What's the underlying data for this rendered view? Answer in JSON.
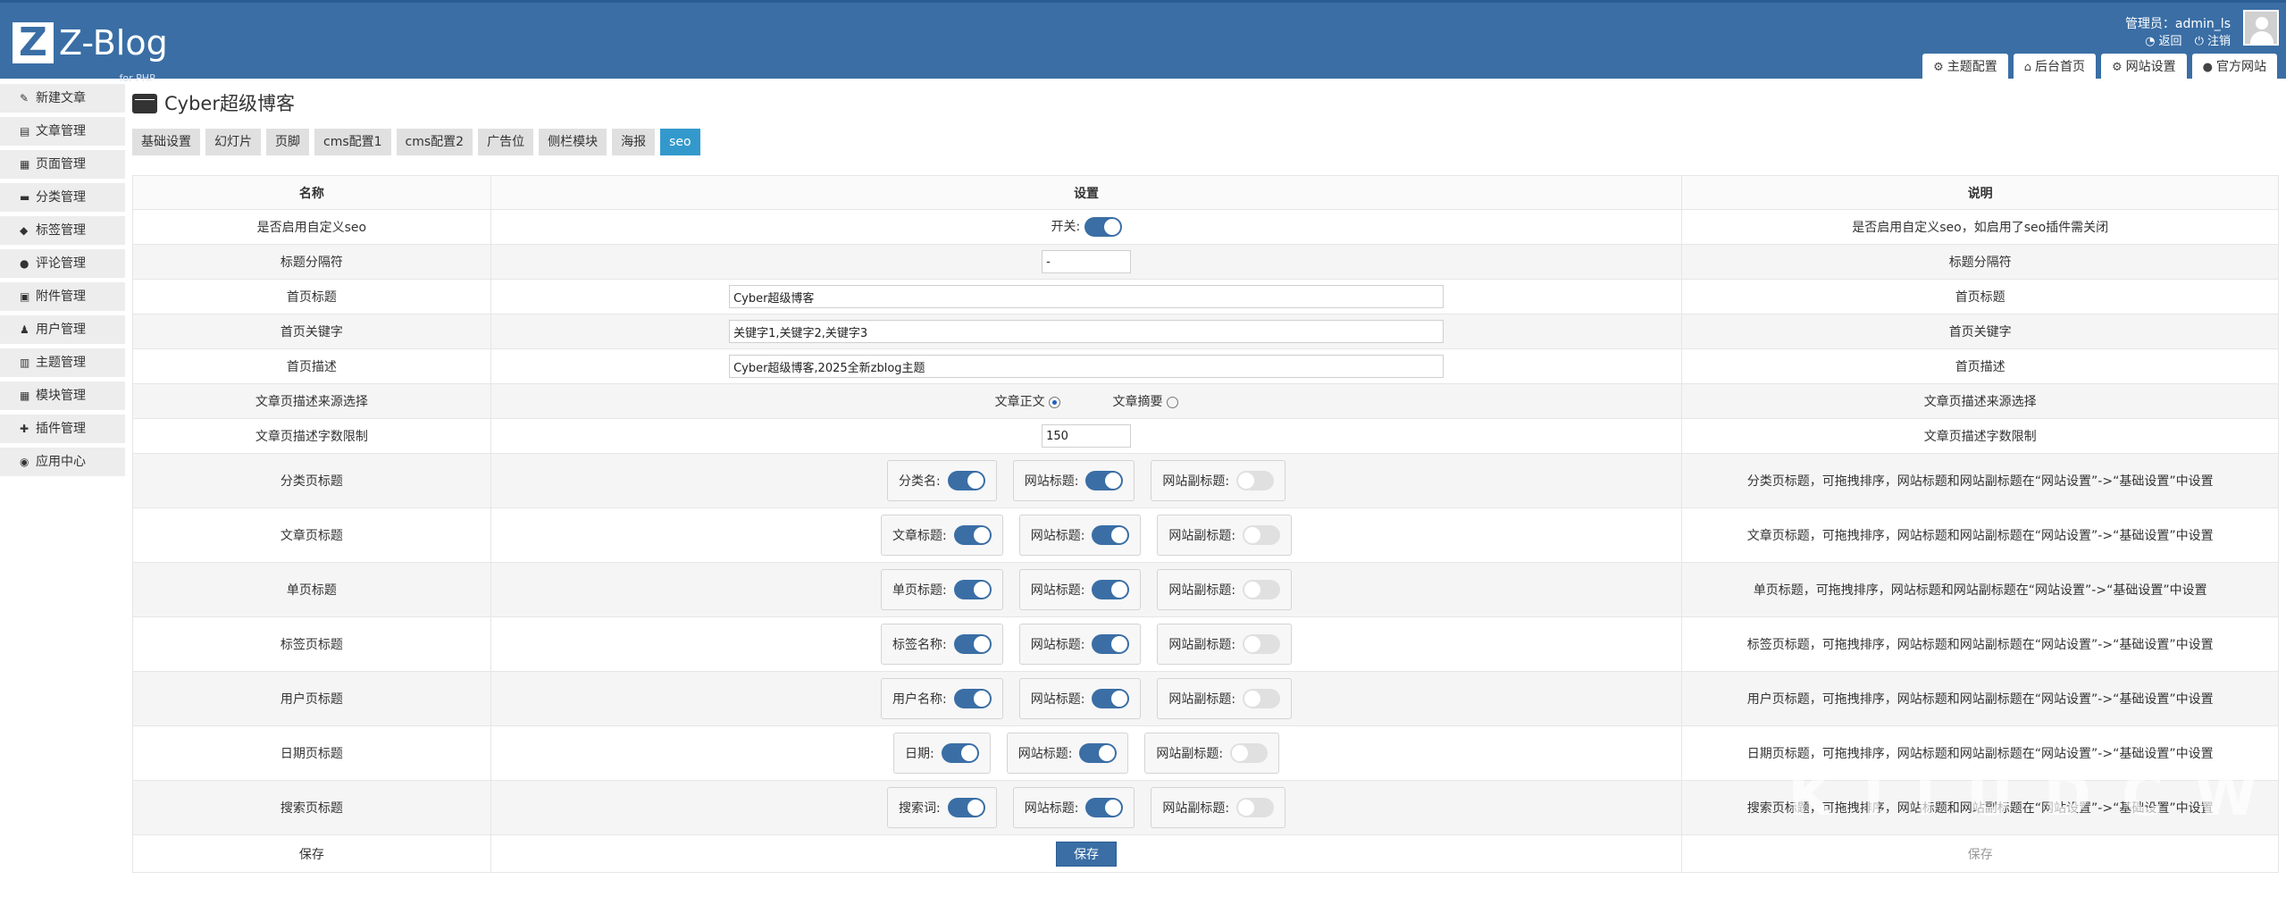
{
  "header": {
    "logo_letter": "Z",
    "logo_text": "Z-Blog",
    "logo_sub": "for PHP",
    "admin_label": "管理员：admin_ls",
    "back_label": "返回",
    "logout_label": "注销",
    "tabs": [
      {
        "icon": "⚙",
        "label": "主题配置"
      },
      {
        "icon": "⌂",
        "label": "后台首页"
      },
      {
        "icon": "⚙",
        "label": "网站设置"
      },
      {
        "icon": "●",
        "label": "官方网站"
      }
    ]
  },
  "sidebar": {
    "items": [
      {
        "icon": "✎",
        "label": "新建文章"
      },
      {
        "icon": "▤",
        "label": "文章管理"
      },
      {
        "icon": "▦",
        "label": "页面管理"
      },
      {
        "icon": "▬",
        "label": "分类管理"
      },
      {
        "icon": "◆",
        "label": "标签管理"
      },
      {
        "icon": "●",
        "label": "评论管理"
      },
      {
        "icon": "▣",
        "label": "附件管理"
      },
      {
        "icon": "♟",
        "label": "用户管理"
      },
      {
        "icon": "▥",
        "label": "主题管理"
      },
      {
        "icon": "▦",
        "label": "模块管理"
      },
      {
        "icon": "✚",
        "label": "插件管理"
      },
      {
        "icon": "◉",
        "label": "应用中心"
      }
    ]
  },
  "main": {
    "title": "Cyber超级博客",
    "tabs": [
      "基础设置",
      "幻灯片",
      "页脚",
      "cms配置1",
      "cms配置2",
      "广告位",
      "侧栏模块",
      "海报",
      "seo"
    ],
    "active_tab": "seo",
    "table": {
      "headers": [
        "名称",
        "设置",
        "说明"
      ],
      "enable_seo": {
        "name": "是否启用自定义seo",
        "switch_label": "开关:",
        "on": true,
        "desc": "是否启用自定义seo，如启用了seo插件需关闭"
      },
      "separator": {
        "name": "标题分隔符",
        "value": "-",
        "desc": "标题分隔符"
      },
      "home_title": {
        "name": "首页标题",
        "value": "Cyber超级博客",
        "desc": "首页标题"
      },
      "home_keywords": {
        "name": "首页关键字",
        "value": "关键字1,关键字2,关键字3",
        "desc": "首页关键字"
      },
      "home_desc": {
        "name": "首页描述",
        "value": "Cyber超级博客,2025全新zblog主题",
        "desc": "首页描述"
      },
      "article_desc_source": {
        "name": "文章页描述来源选择",
        "option1": "文章正文",
        "option2": "文章摘要",
        "selected": "文章正文",
        "desc": "文章页描述来源选择"
      },
      "article_desc_limit": {
        "name": "文章页描述字数限制",
        "value": "150",
        "desc": "文章页描述字数限制"
      },
      "title_rows": [
        {
          "name": "分类页标题",
          "s1": "分类名:",
          "s1_on": true,
          "s2": "网站标题:",
          "s2_on": true,
          "s3": "网站副标题:",
          "s3_on": false,
          "desc": "分类页标题，可拖拽排序，网站标题和网站副标题在“网站设置”->“基础设置”中设置"
        },
        {
          "name": "文章页标题",
          "s1": "文章标题:",
          "s1_on": true,
          "s2": "网站标题:",
          "s2_on": true,
          "s3": "网站副标题:",
          "s3_on": false,
          "desc": "文章页标题，可拖拽排序，网站标题和网站副标题在“网站设置”->“基础设置”中设置"
        },
        {
          "name": "单页标题",
          "s1": "单页标题:",
          "s1_on": true,
          "s2": "网站标题:",
          "s2_on": true,
          "s3": "网站副标题:",
          "s3_on": false,
          "desc": "单页标题，可拖拽排序，网站标题和网站副标题在“网站设置”->“基础设置”中设置"
        },
        {
          "name": "标签页标题",
          "s1": "标签名称:",
          "s1_on": true,
          "s2": "网站标题:",
          "s2_on": true,
          "s3": "网站副标题:",
          "s3_on": false,
          "desc": "标签页标题，可拖拽排序，网站标题和网站副标题在“网站设置”->“基础设置”中设置"
        },
        {
          "name": "用户页标题",
          "s1": "用户名称:",
          "s1_on": true,
          "s2": "网站标题:",
          "s2_on": true,
          "s3": "网站副标题:",
          "s3_on": false,
          "desc": "用户页标题，可拖拽排序，网站标题和网站副标题在“网站设置”->“基础设置”中设置"
        },
        {
          "name": "日期页标题",
          "s1": "日期:",
          "s1_on": true,
          "s2": "网站标题:",
          "s2_on": true,
          "s3": "网站副标题:",
          "s3_on": false,
          "desc": "日期页标题，可拖拽排序，网站标题和网站副标题在“网站设置”->“基础设置”中设置"
        },
        {
          "name": "搜索页标题",
          "s1": "搜索词:",
          "s1_on": true,
          "s2": "网站标题:",
          "s2_on": true,
          "s3": "网站副标题:",
          "s3_on": false,
          "desc": "搜索页标题，可拖拽排序，网站标题和网站副标题在“网站设置”->“基础设置”中设置"
        }
      ],
      "save": {
        "name": "保存",
        "button": "保存",
        "desc": "保存"
      }
    }
  },
  "watermark": "K I I U D C W"
}
